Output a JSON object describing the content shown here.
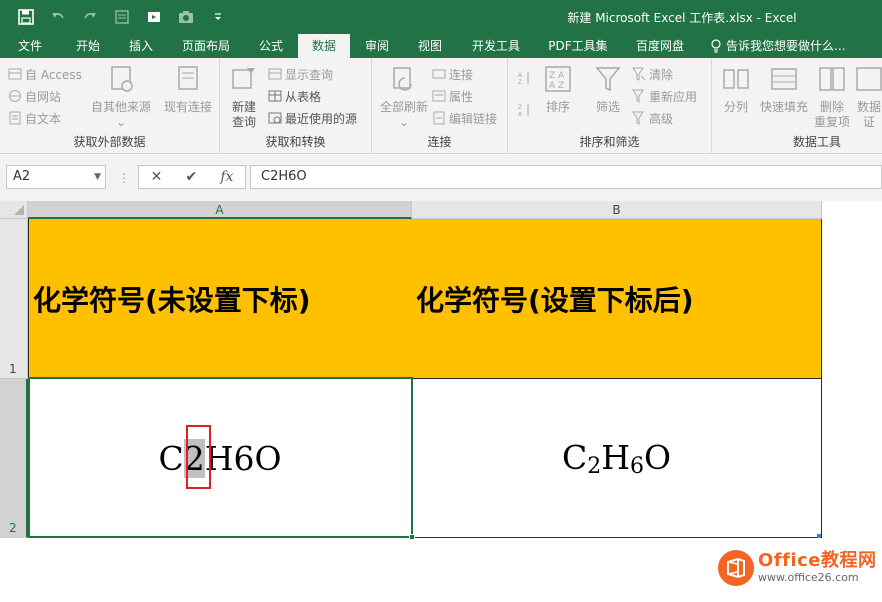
{
  "app": {
    "title": "新建 Microsoft Excel 工作表.xlsx - Excel",
    "accent": "#217346"
  },
  "qat": {
    "icons": [
      "save-icon",
      "undo-icon",
      "redo-icon",
      "form-icon",
      "screen-icon",
      "camera-icon",
      "customize-icon"
    ]
  },
  "tabs": [
    {
      "label": "文件"
    },
    {
      "label": "开始"
    },
    {
      "label": "插入"
    },
    {
      "label": "页面布局"
    },
    {
      "label": "公式"
    },
    {
      "label": "数据"
    },
    {
      "label": "审阅"
    },
    {
      "label": "视图"
    },
    {
      "label": "开发工具"
    },
    {
      "label": "PDF工具集"
    },
    {
      "label": "百度网盘"
    }
  ],
  "tell_me": "告诉我您想要做什么...",
  "ribbon": {
    "group_external": {
      "label": "获取外部数据",
      "from_access": "自 Access",
      "from_web": "自网站",
      "from_text": "自文本",
      "from_other": "自其他来源",
      "existing": "现有连接"
    },
    "group_transform": {
      "label": "获取和转换",
      "new_query_1": "新建",
      "new_query_2": "查询",
      "show_queries": "显示查询",
      "from_table": "从表格",
      "recent_sources": "最近使用的源"
    },
    "group_connections": {
      "label": "连接",
      "refresh_all": "全部刷新",
      "connections": "连接",
      "properties": "属性",
      "edit_links": "编辑链接"
    },
    "group_sort": {
      "label": "排序和筛选",
      "sort": "排序",
      "filter": "筛选",
      "clear": "清除",
      "reapply": "重新应用",
      "advanced": "高级"
    },
    "group_tools": {
      "label": "数据工具",
      "text_to_columns": "分列",
      "flash_fill": "快速填充",
      "remove_dup_1": "删除",
      "remove_dup_2": "重复项",
      "validation_1": "数据",
      "validation_2": "证"
    }
  },
  "formula_bar": {
    "name_box": "A2",
    "cancel": "✕",
    "enter": "✔",
    "fx": "fx",
    "formula": "C2H6O"
  },
  "sheet": {
    "columns": [
      "A",
      "B"
    ],
    "rows": [
      "1",
      "2"
    ],
    "a1": "化学符号(未设置下标)",
    "b1": "化学符号(设置下标后)",
    "a2": {
      "c": "C",
      "sel": "2",
      "rest": "H6O"
    },
    "b2": {
      "c": "C",
      "sub1": "2",
      "h": "H",
      "sub2": "6",
      "o": "O"
    },
    "header_fill": "#ffc000"
  },
  "watermark": {
    "title": "Office教程网",
    "url": "www.office26.com",
    "color": "#f26522"
  }
}
